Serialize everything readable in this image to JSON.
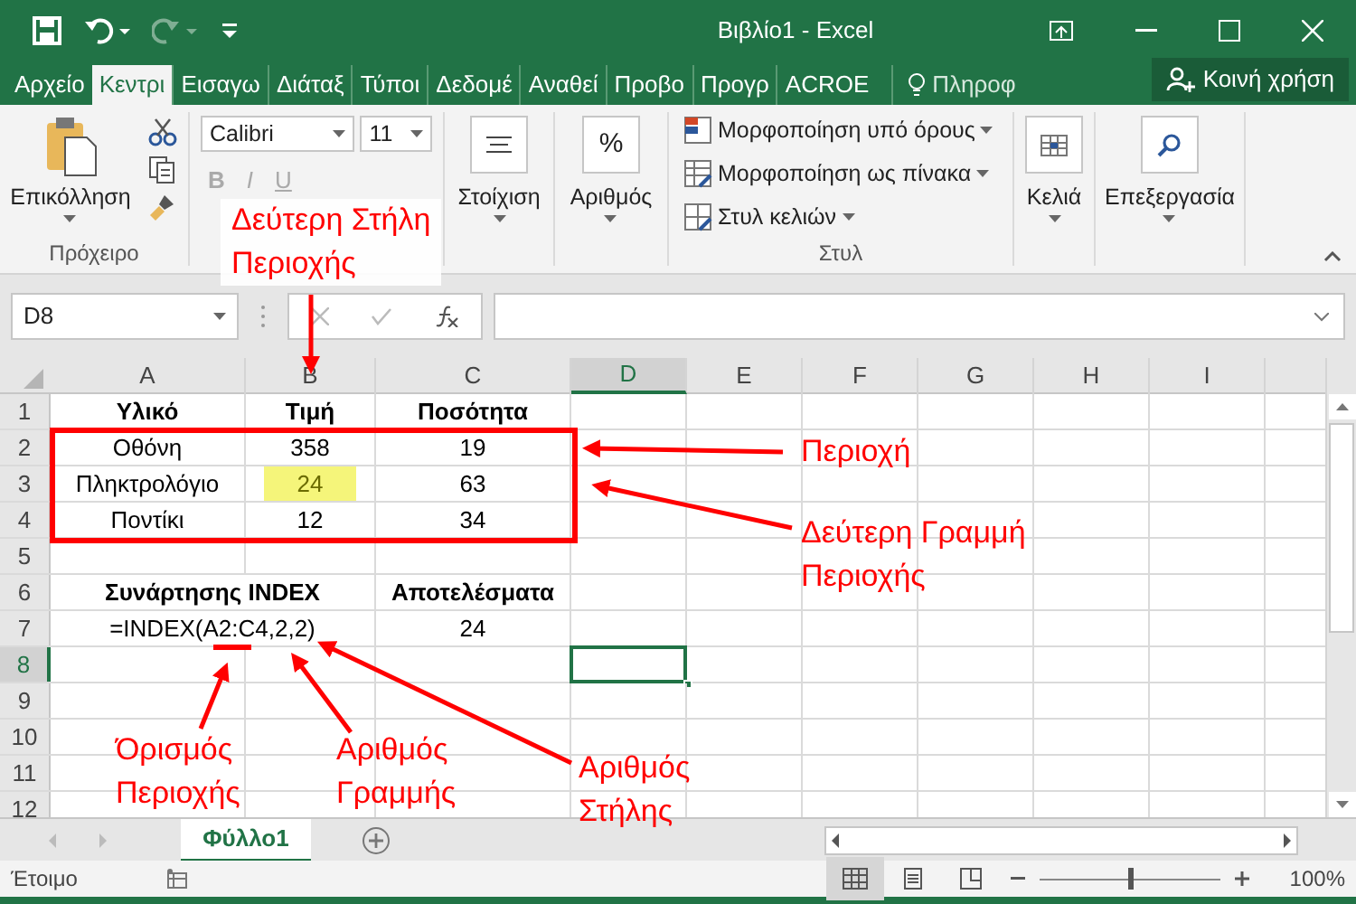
{
  "window": {
    "title": "Βιβλίο1 - Excel"
  },
  "tabs": [
    {
      "label": "Αρχείο",
      "selected": false
    },
    {
      "label": "Κεντρι",
      "selected": true
    },
    {
      "label": "Εισαγω",
      "selected": false
    },
    {
      "label": "Διάταξ",
      "selected": false
    },
    {
      "label": "Τύποι",
      "selected": false
    },
    {
      "label": "Δεδομέ",
      "selected": false
    },
    {
      "label": "Αναθεί",
      "selected": false
    },
    {
      "label": "Προβο",
      "selected": false
    },
    {
      "label": "Προγρ",
      "selected": false
    },
    {
      "label": "ACROE",
      "selected": false
    }
  ],
  "tell_me": "Πληροφ",
  "share_button": "Κοινή χρήση",
  "ribbon": {
    "paste": "Επικόλληση",
    "clipboard_label": "Πρόχειρο",
    "font_name": "Calibri",
    "font_size": "11",
    "bold": "B",
    "italic": "I",
    "underline": "U",
    "alignment": "Στοίχιση",
    "number_symbol": "%",
    "number": "Αριθμός",
    "styles": [
      "Μορφοποίηση υπό όρους",
      "Μορφοποίηση ως πίνακα",
      "Στυλ κελιών"
    ],
    "styles_label": "Στυλ",
    "cells": "Κελιά",
    "editing": "Επεξεργασία"
  },
  "name_box": "D8",
  "columns": [
    {
      "label": "A",
      "selected": false
    },
    {
      "label": "B",
      "selected": false
    },
    {
      "label": "C",
      "selected": false
    },
    {
      "label": "D",
      "selected": true
    },
    {
      "label": "E",
      "selected": false
    },
    {
      "label": "F",
      "selected": false
    },
    {
      "label": "G",
      "selected": false
    },
    {
      "label": "H",
      "selected": false
    },
    {
      "label": "I",
      "selected": false
    }
  ],
  "rows": [
    {
      "number": "1",
      "selected": false,
      "cells": [
        {
          "text": "Υλικό",
          "bold": true
        },
        {
          "text": "Τιμή",
          "bold": true
        },
        {
          "text": "Ποσότητα",
          "bold": true
        }
      ]
    },
    {
      "number": "2",
      "selected": false,
      "cells": [
        {
          "text": "Οθόνη"
        },
        {
          "text": "358"
        },
        {
          "text": "19"
        }
      ]
    },
    {
      "number": "3",
      "selected": false,
      "cells": [
        {
          "text": "Πληκτρολόγιο"
        },
        {
          "text": "24",
          "highlighted": true
        },
        {
          "text": "63"
        }
      ]
    },
    {
      "number": "4",
      "selected": false,
      "cells": [
        {
          "text": "Ποντίκι"
        },
        {
          "text": "12"
        },
        {
          "text": "34"
        }
      ]
    },
    {
      "number": "5",
      "selected": false,
      "cells": []
    },
    {
      "number": "6",
      "selected": false,
      "cells": [
        {
          "text": "Συνάρτησης INDEX",
          "bold": true,
          "merged": true
        },
        {
          "text": "Αποτελέσματα",
          "bold": true
        }
      ]
    },
    {
      "number": "7",
      "selected": false,
      "cells": [
        {
          "text": "=INDEX(A2:C4,2,2)",
          "merged": true
        },
        {
          "text": "24"
        }
      ]
    },
    {
      "number": "8",
      "selected": true,
      "cells": []
    },
    {
      "number": "9",
      "selected": false,
      "cells": []
    },
    {
      "number": "10",
      "selected": false,
      "cells": []
    },
    {
      "number": "11",
      "selected": false,
      "cells": []
    },
    {
      "number": "12",
      "selected": false,
      "cells": []
    }
  ],
  "annotations": [
    {
      "lines": [
        "Δεύτερη Στήλη",
        "Περιοχής"
      ],
      "kind": "ribbon"
    },
    {
      "lines": [
        "Περιοχή"
      ],
      "kind": "plain"
    },
    {
      "lines": [
        "Δεύτερη Γραμμή",
        "Περιοχής"
      ],
      "kind": "plain"
    },
    {
      "lines": [
        "Όρισμός",
        "Περιοχής"
      ],
      "kind": "plain"
    },
    {
      "lines": [
        "Αριθμός",
        "Γραμμής"
      ],
      "kind": "plain"
    },
    {
      "lines": [
        "Αριθμός",
        "Στήλης"
      ],
      "kind": "plain"
    }
  ],
  "sheet_tab": {
    "label": "Φύλλο1",
    "selected": true
  },
  "status_bar": {
    "status": "Έτοιμο",
    "zoom": "100%",
    "level": 0.5
  }
}
